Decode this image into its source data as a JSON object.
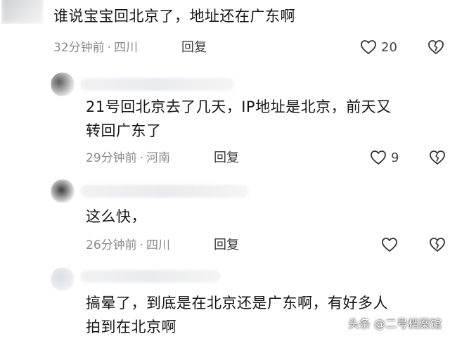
{
  "comments": [
    {
      "text": "谁说宝宝回北京了，地址还在广东啊",
      "time": "32分钟前",
      "location": "四川",
      "reply_label": "回复",
      "likes": "20"
    },
    {
      "text_line1": "21号回北京去了几天，IP地址是北京，前天又",
      "text_line2": "转回广东了",
      "time": "29分钟前",
      "location": "河南",
      "reply_label": "回复",
      "likes": "9"
    },
    {
      "text": "这么快，",
      "time": "26分钟前",
      "location": "四川",
      "reply_label": "回复",
      "likes": ""
    },
    {
      "text_line1": "搞晕了，到底是在北京还是广东啊，有好多人",
      "text_line2": "拍到在北京啊"
    }
  ],
  "separator": "·",
  "watermark": "头条 @二号档案馆",
  "colors": {
    "meta": "#8a8a8a",
    "text": "#161616",
    "icon": "#333333"
  },
  "icons": {
    "like": "heart-outline-icon",
    "dislike": "broken-heart-icon"
  }
}
